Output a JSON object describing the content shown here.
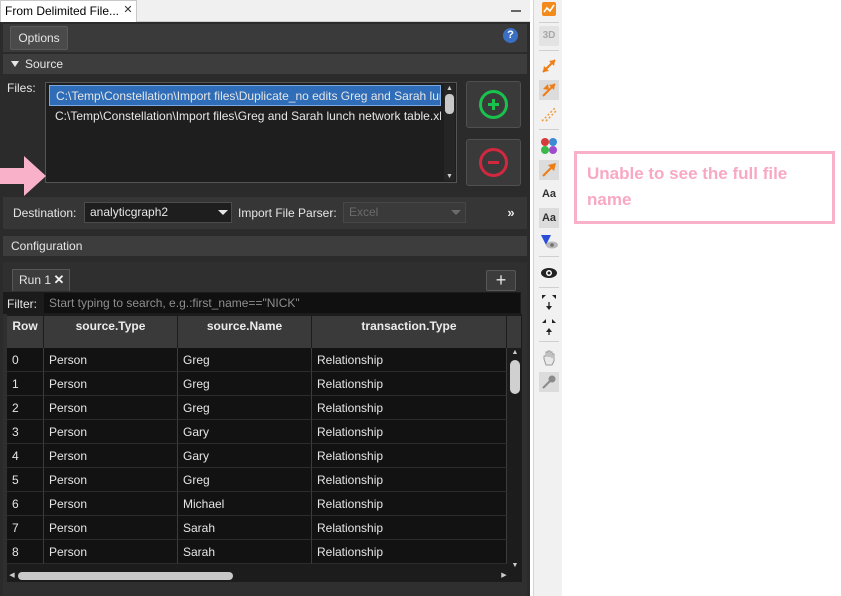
{
  "window": {
    "tab_title": "From Delimited File...",
    "close_glyph": "✕"
  },
  "toolbar": {
    "options_label": "Options",
    "help_glyph": "?"
  },
  "source": {
    "section_title": "Source",
    "files_label": "Files:",
    "files": [
      "C:\\Temp\\Constellation\\Import files\\Duplicate_no edits Greg and Sarah lunch",
      "C:\\Temp\\Constellation\\Import files\\Greg and Sarah lunch network table.xlsx"
    ],
    "destination_label": "Destination:",
    "destination_value": "analyticgraph2",
    "parser_label": "Import File Parser:",
    "parser_value": "Excel",
    "expand_glyph": "»"
  },
  "configuration": {
    "section_title": "Configuration",
    "run_tab_label": "Run 1",
    "run_close_glyph": "✕",
    "add_run_glyph": "+",
    "filter_label": "Filter:",
    "filter_placeholder": "Start typing to search, e.g.:first_name==\"NICK\"",
    "columns": [
      "Row",
      "source.Type",
      "source.Name",
      "transaction.Type"
    ],
    "rows": [
      [
        "0",
        "Person",
        "Greg",
        "Relationship"
      ],
      [
        "1",
        "Person",
        "Greg",
        "Relationship"
      ],
      [
        "2",
        "Person",
        "Greg",
        "Relationship"
      ],
      [
        "3",
        "Person",
        "Gary",
        "Relationship"
      ],
      [
        "4",
        "Person",
        "Gary",
        "Relationship"
      ],
      [
        "5",
        "Person",
        "Greg",
        "Relationship"
      ],
      [
        "6",
        "Person",
        "Michael",
        "Relationship"
      ],
      [
        "7",
        "Person",
        "Sarah",
        "Relationship"
      ],
      [
        "8",
        "Person",
        "Sarah",
        "Relationship"
      ]
    ]
  },
  "side_toolbar": {
    "label_3d": "3D",
    "label_aa": "Aa",
    "icons": [
      "chart-icon",
      "3d-toggle-icon",
      "draw-link-icon",
      "draw-link-selected-icon",
      "dashed-link-icon",
      "color-palette-icon",
      "arrow-icon",
      "label-text-icon",
      "label-text-selected-icon",
      "blaze-eye-icon",
      "visibility-icon",
      "expand-icon",
      "contract-icon",
      "hand-icon",
      "pin-icon"
    ]
  },
  "annotation": {
    "text": "Unable to see the full file name",
    "color": "#f9a8c4"
  },
  "colors": {
    "accent_selection": "#2f6db8",
    "add_green": "#19c24c",
    "remove_red": "#d12840",
    "panel_dark": "#2b2b2b"
  }
}
